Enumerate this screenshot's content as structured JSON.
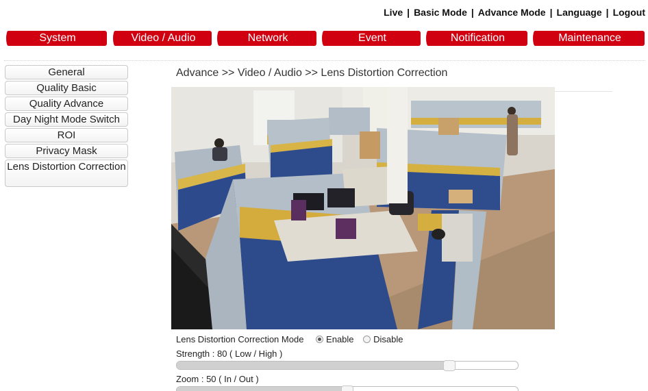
{
  "top_links": [
    "Live",
    "Basic Mode",
    "Advance Mode",
    "Language",
    "Logout"
  ],
  "top_separator": "|",
  "nav_tabs": [
    "System",
    "Video / Audio",
    "Network",
    "Event",
    "Notification",
    "Maintenance"
  ],
  "colors": {
    "nav_red": "#d00010"
  },
  "sidebar": {
    "items": [
      "General",
      "Quality Basic",
      "Quality Advance",
      "Day Night Mode Switch",
      "ROI",
      "Privacy Mask",
      "Lens Distortion Correction"
    ]
  },
  "breadcrumb": "Advance >> Video / Audio >> Lens Distortion Correction",
  "video": {
    "icon": "camera-live-view"
  },
  "controls": {
    "mode_label": "Lens Distortion Correction Mode",
    "enable_label": "Enable",
    "disable_label": "Disable",
    "mode_selected": "Enable",
    "strength_label": "Strength : 80 ( Low / High )",
    "strength_value": 80,
    "zoom_label": "Zoom : 50 ( In / Out )",
    "zoom_value": 50
  }
}
